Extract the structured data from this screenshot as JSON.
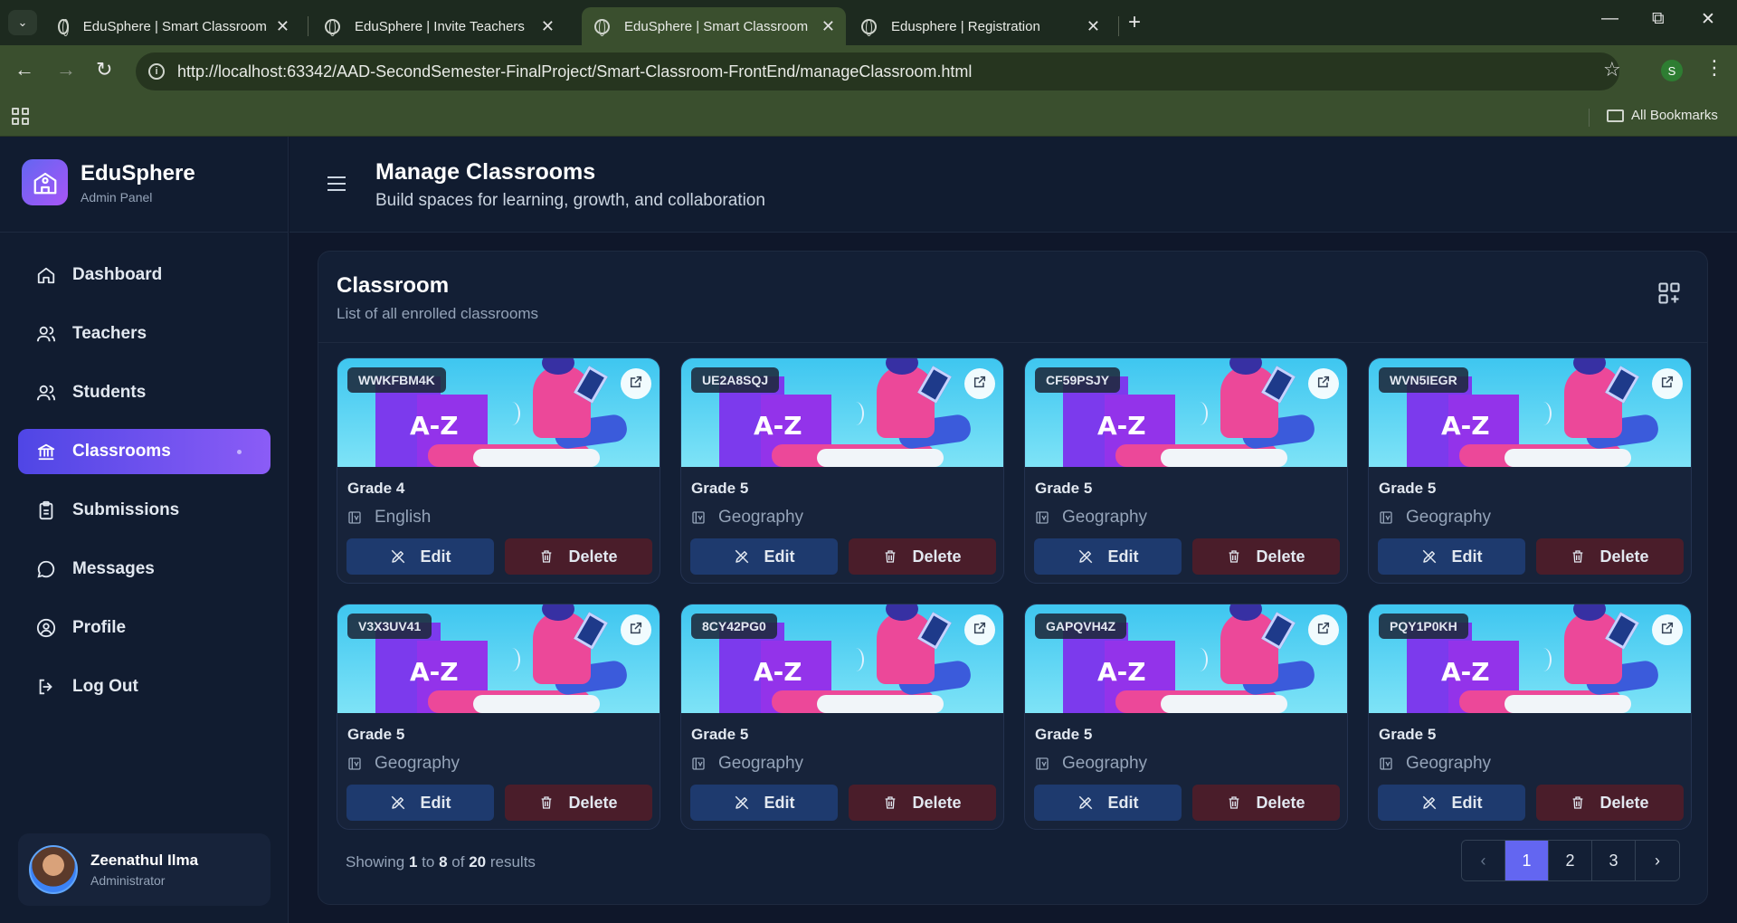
{
  "browser": {
    "tabs": [
      {
        "title": "EduSphere | Smart Classroom",
        "active": false
      },
      {
        "title": "EduSphere | Invite Teachers",
        "active": false
      },
      {
        "title": "EduSphere | Smart Classroom",
        "active": true
      },
      {
        "title": "Edusphere | Registration",
        "active": false
      }
    ],
    "url": "http://localhost:63342/AAD-SecondSemester-FinalProject/Smart-Classroom-FrontEnd/manageClassroom.html",
    "profile_initial": "S",
    "all_bookmarks": "All Bookmarks"
  },
  "sidebar": {
    "brand_name": "EduSphere",
    "brand_sub": "Admin Panel",
    "items": [
      {
        "label": "Dashboard",
        "icon": "home-icon"
      },
      {
        "label": "Teachers",
        "icon": "users-icon"
      },
      {
        "label": "Students",
        "icon": "users-icon"
      },
      {
        "label": "Classrooms",
        "icon": "bank-icon"
      },
      {
        "label": "Submissions",
        "icon": "clipboard-icon"
      },
      {
        "label": "Messages",
        "icon": "chat-icon"
      },
      {
        "label": "Profile",
        "icon": "user-circle-icon"
      },
      {
        "label": "Log Out",
        "icon": "logout-icon"
      }
    ],
    "user": {
      "name": "Zeenathul Ilma",
      "role": "Administrator"
    }
  },
  "header": {
    "title": "Manage Classrooms",
    "subtitle": "Build spaces for learning, growth, and collaboration"
  },
  "panel": {
    "title": "Classroom",
    "subtitle": "List of all enrolled classrooms",
    "edit_label": "Edit",
    "delete_label": "Delete",
    "cards": [
      {
        "code": "WWKFBM4K",
        "grade": "Grade 4",
        "subject": "English"
      },
      {
        "code": "UE2A8SQJ",
        "grade": "Grade 5",
        "subject": "Geography"
      },
      {
        "code": "CF59PSJY",
        "grade": "Grade 5",
        "subject": "Geography"
      },
      {
        "code": "WVN5IEGR",
        "grade": "Grade 5",
        "subject": "Geography"
      },
      {
        "code": "V3X3UV41",
        "grade": "Grade 5",
        "subject": "Geography"
      },
      {
        "code": "8CY42PG0",
        "grade": "Grade 5",
        "subject": "Geography"
      },
      {
        "code": "GAPQVH4Z",
        "grade": "Grade 5",
        "subject": "Geography"
      },
      {
        "code": "PQY1P0KH",
        "grade": "Grade 5",
        "subject": "Geography"
      }
    ],
    "footer": {
      "prefix": "Showing",
      "from": "1",
      "to_word": "to",
      "to": "8",
      "of_word": "of",
      "total": "20",
      "suffix": "results"
    },
    "pages": [
      "1",
      "2",
      "3"
    ],
    "current_page": "1"
  },
  "colors": {
    "accent": "#6366f1",
    "accent2": "#8b5cf6",
    "edit_bg": "#1e3a6e",
    "delete_bg": "#4a1d2a"
  }
}
